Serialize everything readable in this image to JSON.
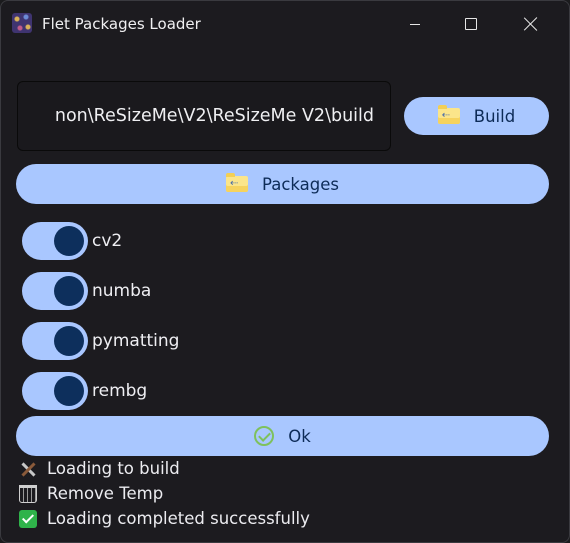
{
  "window": {
    "title": "Flet Packages Loader",
    "icons": {
      "app": "app-logo-icon",
      "minimize": "minimize-icon",
      "maximize": "maximize-icon",
      "close": "close-icon"
    }
  },
  "build_path": {
    "value": "non\\ReSizeMe\\V2\\ReSizeMe V2\\build"
  },
  "buttons": {
    "build_label": "Build",
    "packages_label": "Packages",
    "ok_label": "Ok",
    "icons": {
      "build": "folder-open-icon",
      "packages": "folder-open-icon",
      "ok": "check-circle-icon"
    }
  },
  "packages": [
    {
      "name": "cv2",
      "enabled": true
    },
    {
      "name": "numba",
      "enabled": true
    },
    {
      "name": "pymatting",
      "enabled": true
    },
    {
      "name": "rembg",
      "enabled": true
    }
  ],
  "log": [
    {
      "icon": "tools-icon",
      "text": "Loading to build"
    },
    {
      "icon": "trash-icon",
      "text": "Remove Temp"
    },
    {
      "icon": "check-mark-icon",
      "text": "Loading completed successfully"
    }
  ],
  "colors": {
    "background": "#1c1b1f",
    "accent": "#a9c7ff",
    "accent_text": "#0d2b57",
    "switch_knob": "#0d2f5c",
    "success": "#2fb34a"
  }
}
